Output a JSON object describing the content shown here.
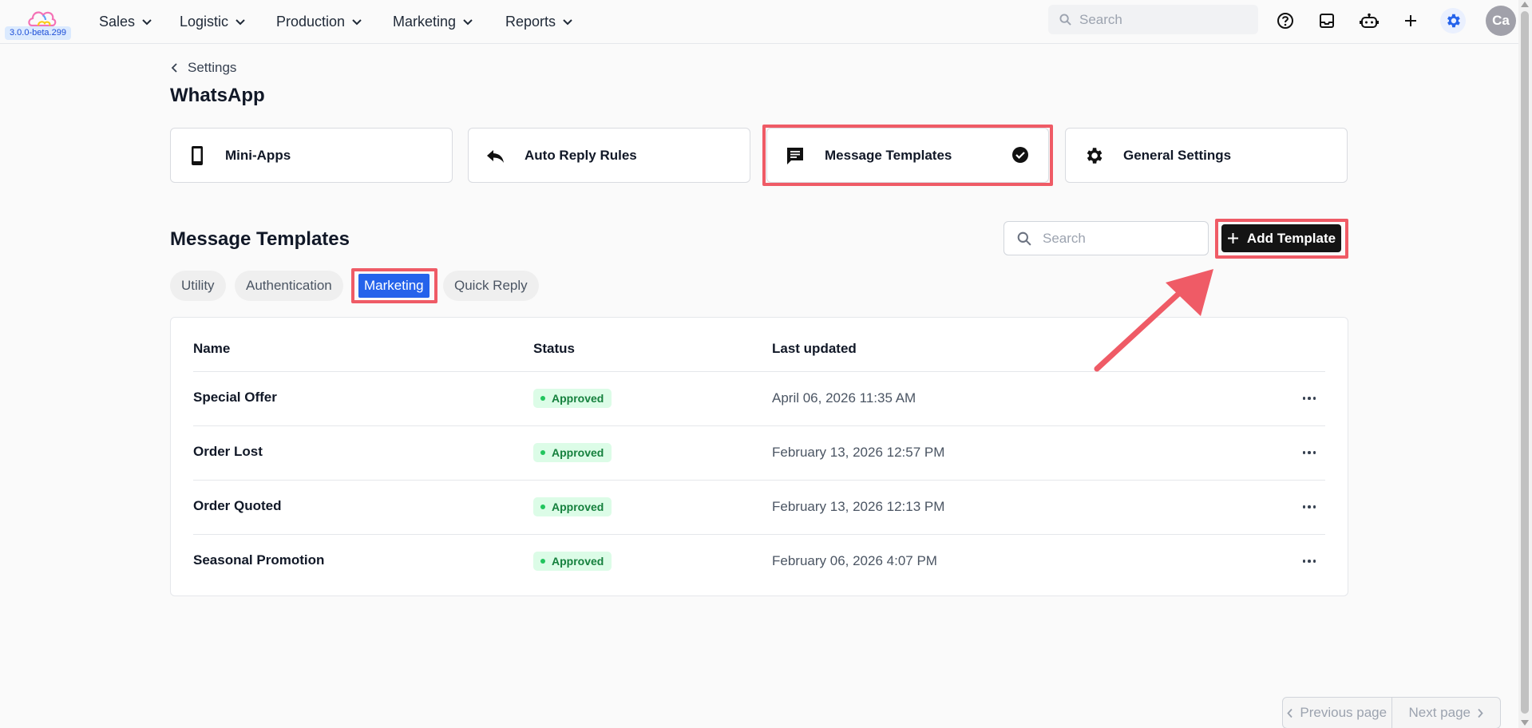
{
  "app": {
    "version": "3.0.0-beta.299"
  },
  "nav": {
    "items": [
      {
        "label": "Sales"
      },
      {
        "label": "Logistic"
      },
      {
        "label": "Production"
      },
      {
        "label": "Marketing"
      },
      {
        "label": "Reports"
      }
    ],
    "search_placeholder": "Search",
    "avatar_initials": "Ca"
  },
  "breadcrumb": {
    "label": "Settings"
  },
  "page": {
    "title": "WhatsApp"
  },
  "cards": [
    {
      "label": "Mini-Apps",
      "icon": "phone-icon"
    },
    {
      "label": "Auto Reply Rules",
      "icon": "reply-icon"
    },
    {
      "label": "Message Templates",
      "icon": "message-icon",
      "selected": true
    },
    {
      "label": "General Settings",
      "icon": "gear-icon"
    }
  ],
  "section": {
    "title": "Message Templates",
    "search_placeholder": "Search",
    "add_label": "Add Template"
  },
  "tabs": [
    {
      "label": "Utility"
    },
    {
      "label": "Authentication"
    },
    {
      "label": "Marketing",
      "active": true
    },
    {
      "label": "Quick Reply"
    }
  ],
  "table": {
    "headers": {
      "name": "Name",
      "status": "Status",
      "updated": "Last updated"
    },
    "rows": [
      {
        "name": "Special Offer",
        "status": "Approved",
        "updated": "April 06, 2026 11:35 AM"
      },
      {
        "name": "Order Lost",
        "status": "Approved",
        "updated": "February 13, 2026 12:57 PM"
      },
      {
        "name": "Order Quoted",
        "status": "Approved",
        "updated": "February 13, 2026 12:13 PM"
      },
      {
        "name": "Seasonal Promotion",
        "status": "Approved",
        "updated": "February 06, 2026 4:07 PM"
      }
    ]
  },
  "pagination": {
    "previous": "Previous page",
    "next": "Next page"
  },
  "colors": {
    "accent": "#2563eb",
    "highlight": "#ef5b66",
    "approved_bg": "#dcfce7",
    "approved_text": "#15803d"
  }
}
